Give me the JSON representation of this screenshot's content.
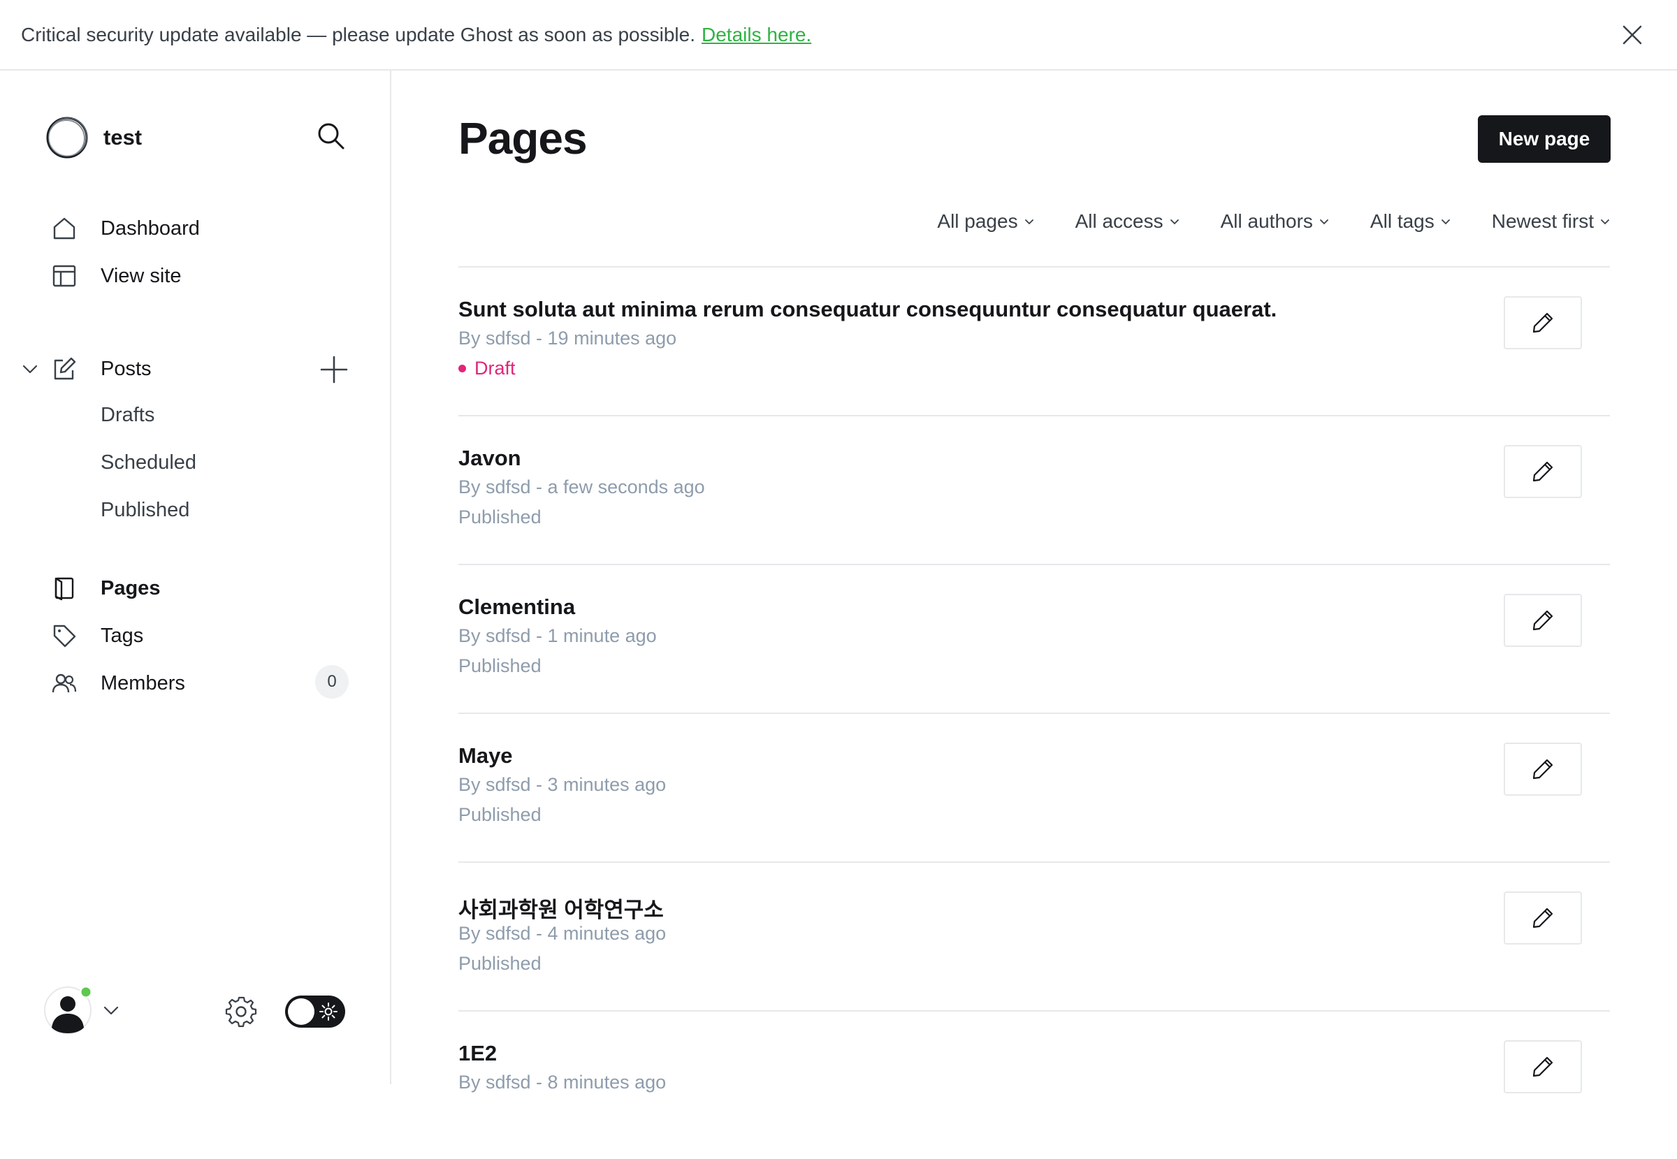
{
  "banner": {
    "message": "Critical security update available — please update Ghost as soon as possible.",
    "link_text": "Details here."
  },
  "sidebar": {
    "site_name": "test",
    "nav": {
      "dashboard": "Dashboard",
      "view_site": "View site",
      "posts": "Posts",
      "drafts": "Drafts",
      "scheduled": "Scheduled",
      "published": "Published",
      "pages": "Pages",
      "tags": "Tags",
      "members": "Members"
    },
    "members_count": "0"
  },
  "main": {
    "title": "Pages",
    "new_button": "New page",
    "filters": [
      "All pages",
      "All access",
      "All authors",
      "All tags",
      "Newest first"
    ],
    "rows": [
      {
        "title": "Sunt soluta aut minima rerum consequatur consequuntur consequatur quaerat.",
        "meta": "By sdfsd - 19 minutes ago",
        "status": "Draft"
      },
      {
        "title": "Javon",
        "meta": "By sdfsd - a few seconds ago",
        "status": "Published"
      },
      {
        "title": "Clementina",
        "meta": "By sdfsd - 1 minute ago",
        "status": "Published"
      },
      {
        "title": "Maye",
        "meta": "By sdfsd - 3 minutes ago",
        "status": "Published"
      },
      {
        "title": "사회과학원 어학연구소",
        "meta": "By sdfsd - 4 minutes ago",
        "status": "Published"
      },
      {
        "title": "1E2",
        "meta": "By sdfsd - 8 minutes ago",
        "status": ""
      }
    ]
  },
  "colors": {
    "accent_green": "#2fb344",
    "draft_pink": "#e2257a",
    "dark": "#15171a",
    "muted": "#8e9cac",
    "online_dot": "#5cc84d"
  }
}
